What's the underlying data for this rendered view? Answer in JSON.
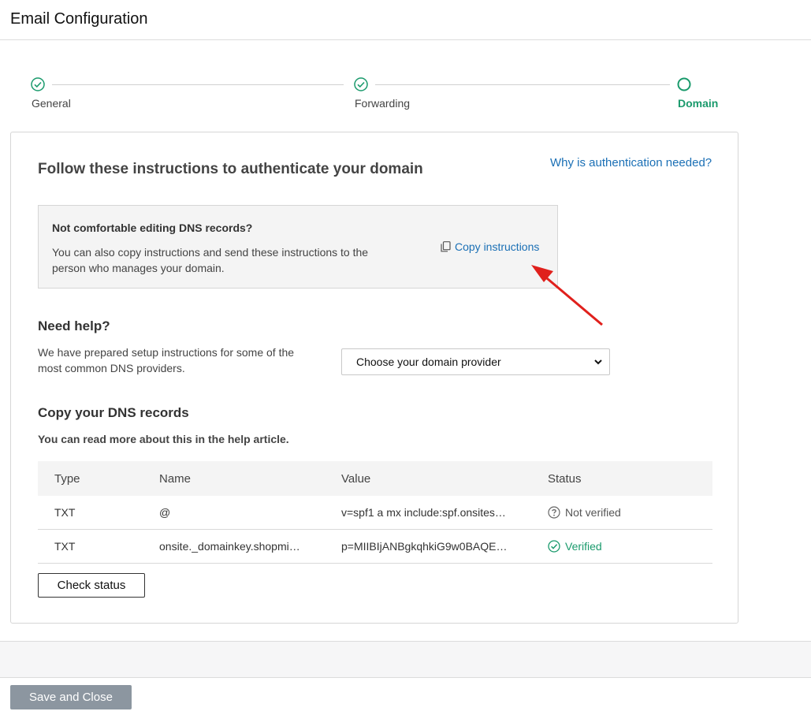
{
  "window": {
    "title": "Email Configuration"
  },
  "stepper": {
    "steps": [
      {
        "label": "General",
        "state": "complete"
      },
      {
        "label": "Forwarding",
        "state": "complete"
      },
      {
        "label": "Domain",
        "state": "current"
      }
    ],
    "active_color": "#1a9a6c"
  },
  "card": {
    "title": "Follow these instructions to authenticate your domain",
    "why_link": "Why is authentication needed?"
  },
  "dns_box": {
    "question": "Not comfortable editing DNS records?",
    "description": "You can also copy instructions and send these instructions to the person who manages your domain.",
    "copy_link": "Copy instructions",
    "copy_icon": "copy-icon"
  },
  "help": {
    "title": "Need help?",
    "description": "We have prepared setup instructions for some of the most common DNS providers.",
    "select_value": "Choose your domain provider"
  },
  "records": {
    "title": "Copy your DNS records",
    "subtitle": "You can read more about this in the help article.",
    "columns": [
      "Type",
      "Name",
      "Value",
      "Status"
    ],
    "rows": [
      {
        "type": "TXT",
        "name": "@",
        "value": "v=spf1 a mx include:spf.onsites…",
        "status": "Not verified",
        "status_icon": "question-circle-icon"
      },
      {
        "type": "TXT",
        "name": "onsite._domainkey.shopmi…",
        "value": "p=MIIBIjANBgkqhkiG9w0BAQE…",
        "status": "Verified",
        "status_icon": "check-circle-icon"
      }
    ],
    "check_button": "Check status"
  },
  "footer": {
    "save_button": "Save and Close"
  },
  "colors": {
    "link": "#1a6fb5",
    "success": "#1a9a6c",
    "annotation_arrow": "#e0201c",
    "save_button_bg": "#8c96a0"
  }
}
